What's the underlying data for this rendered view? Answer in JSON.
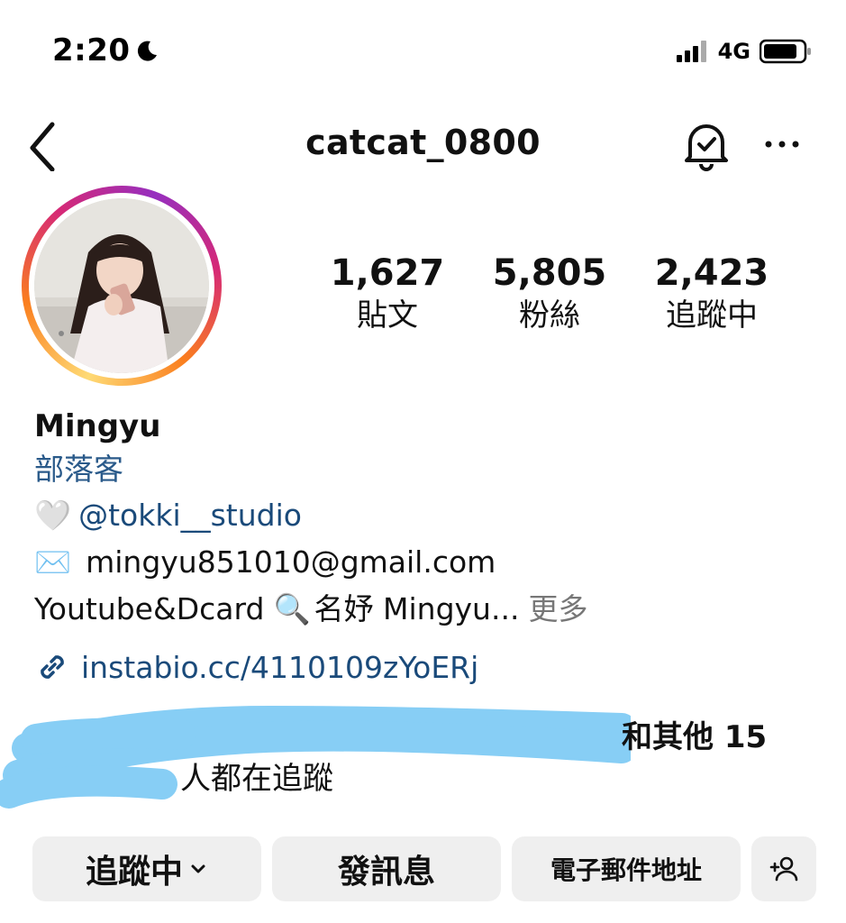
{
  "status_bar": {
    "time": "2:20",
    "network": "4G"
  },
  "header": {
    "username": "catcat_0800",
    "icons": [
      "back-icon",
      "bell-icon",
      "more-icon"
    ]
  },
  "stats": [
    {
      "value": "1,627",
      "label": "貼文"
    },
    {
      "value": "5,805",
      "label": "粉絲"
    },
    {
      "value": "2,423",
      "label": "追蹤中"
    }
  ],
  "bio": {
    "name": "Mingyu",
    "category": "部落客",
    "mention_emoji": "🤍",
    "mention": "@tokki__studio",
    "email_emoji": "✉️",
    "email": "mingyu851010@gmail.com",
    "line3_text": "Youtube&Dcard",
    "line3_emoji": "🔍",
    "line3_rest": "名妤 Mingyu...",
    "more": "更多",
    "link": "instabio.cc/4110109zYoERj"
  },
  "followed_by": {
    "bold_part": "和其他 15",
    "rest": "人都在追蹤"
  },
  "actions": {
    "following": "追蹤中",
    "message": "發訊息",
    "email": "電子郵件地址"
  },
  "colors": {
    "link": "#1a4a7a",
    "button_bg": "#efefef",
    "scribble": "#87cef5"
  }
}
